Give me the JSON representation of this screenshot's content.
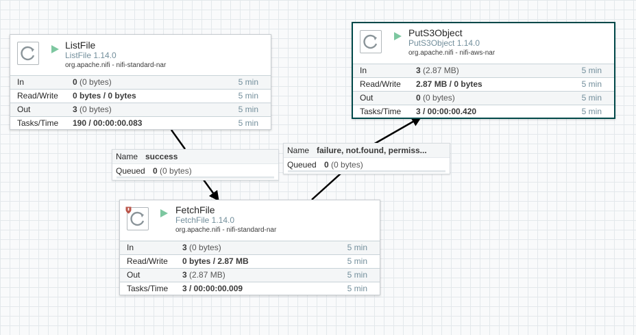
{
  "processors": {
    "listfile": {
      "name": "ListFile",
      "type": "ListFile 1.14.0",
      "bundle": "org.apache.nifi - nifi-standard-nar",
      "run_state": "running",
      "stats": {
        "in": {
          "label": "In",
          "count": "0",
          "size": "(0 bytes)",
          "time": "5 min"
        },
        "rw": {
          "label": "Read/Write",
          "value": "0 bytes / 0 bytes",
          "time": "5 min"
        },
        "out": {
          "label": "Out",
          "count": "3",
          "size": "(0 bytes)",
          "time": "5 min"
        },
        "tasks": {
          "label": "Tasks/Time",
          "value": "190 / 00:00:00.083",
          "time": "5 min"
        }
      }
    },
    "fetchfile": {
      "name": "FetchFile",
      "type": "FetchFile 1.14.0",
      "bundle": "org.apache.nifi - nifi-standard-nar",
      "run_state": "running",
      "has_bulletin": true,
      "stats": {
        "in": {
          "label": "In",
          "count": "3",
          "size": "(0 bytes)",
          "time": "5 min"
        },
        "rw": {
          "label": "Read/Write",
          "value": "0 bytes / 2.87 MB",
          "time": "5 min"
        },
        "out": {
          "label": "Out",
          "count": "3",
          "size": "(2.87 MB)",
          "time": "5 min"
        },
        "tasks": {
          "label": "Tasks/Time",
          "value": "3 / 00:00:00.009",
          "time": "5 min"
        }
      }
    },
    "puts3object": {
      "name": "PutS3Object",
      "type": "PutS3Object 1.14.0",
      "bundle": "org.apache.nifi - nifi-aws-nar",
      "run_state": "running",
      "selected": true,
      "stats": {
        "in": {
          "label": "In",
          "count": "3",
          "size": "(2.87 MB)",
          "time": "5 min"
        },
        "rw": {
          "label": "Read/Write",
          "value": "2.87 MB / 0 bytes",
          "time": "5 min"
        },
        "out": {
          "label": "Out",
          "count": "0",
          "size": "(0 bytes)",
          "time": "5 min"
        },
        "tasks": {
          "label": "Tasks/Time",
          "value": "3 / 00:00:00.420",
          "time": "5 min"
        }
      }
    }
  },
  "connections": {
    "success": {
      "name_label": "Name",
      "name": "success",
      "queued_label": "Queued",
      "queued_count": "0",
      "queued_size": "(0 bytes)"
    },
    "failure": {
      "name_label": "Name",
      "name": "failure, not.found, permiss...",
      "queued_label": "Queued",
      "queued_count": "0",
      "queued_size": "(0 bytes)"
    }
  },
  "colors": {
    "run_state": "#7dc7a0",
    "selected_border": "#004849",
    "type_text": "#728e9b",
    "bulletin": "#ba554a"
  }
}
